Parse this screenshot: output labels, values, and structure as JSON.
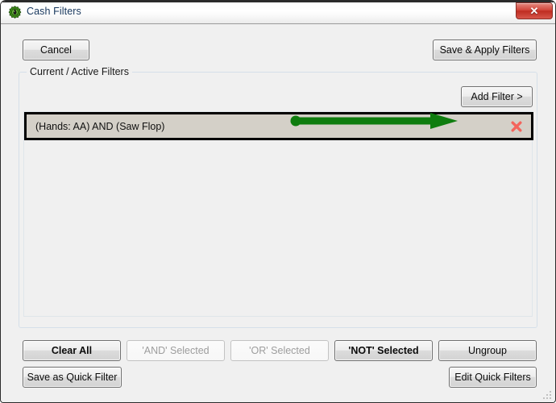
{
  "window": {
    "title": "Cash Filters",
    "icon": "app-gear-icon",
    "close_label": "✕"
  },
  "toolbar": {
    "cancel_label": "Cancel",
    "save_apply_label": "Save & Apply Filters"
  },
  "groupbox": {
    "legend": "Current / Active Filters",
    "add_filter_label": "Add Filter >"
  },
  "filters": {
    "items": [
      {
        "text": "(Hands: AA) AND (Saw Flop)",
        "delete_icon": "red-x-delete-icon",
        "selected": true
      }
    ]
  },
  "annotation": {
    "type": "arrow",
    "color": "#0f7d0f",
    "points_to": "Add Filter >"
  },
  "actions": {
    "row1": [
      {
        "label": "Clear All",
        "enabled": true
      },
      {
        "label": "'AND' Selected",
        "enabled": false
      },
      {
        "label": "'OR' Selected",
        "enabled": false
      },
      {
        "label": "'NOT' Selected",
        "enabled": true
      },
      {
        "label": "Ungroup",
        "enabled": true
      }
    ],
    "row2_left": {
      "label": "Save as Quick Filter",
      "enabled": true
    },
    "row2_right": {
      "label": "Edit Quick Filters",
      "enabled": true
    }
  },
  "colors": {
    "title_text": "#16365c",
    "close_button": "#c23126",
    "annotation_green": "#0f7d0f",
    "delete_x": "#f4645c",
    "selection_fill": "#d4d0c8"
  }
}
